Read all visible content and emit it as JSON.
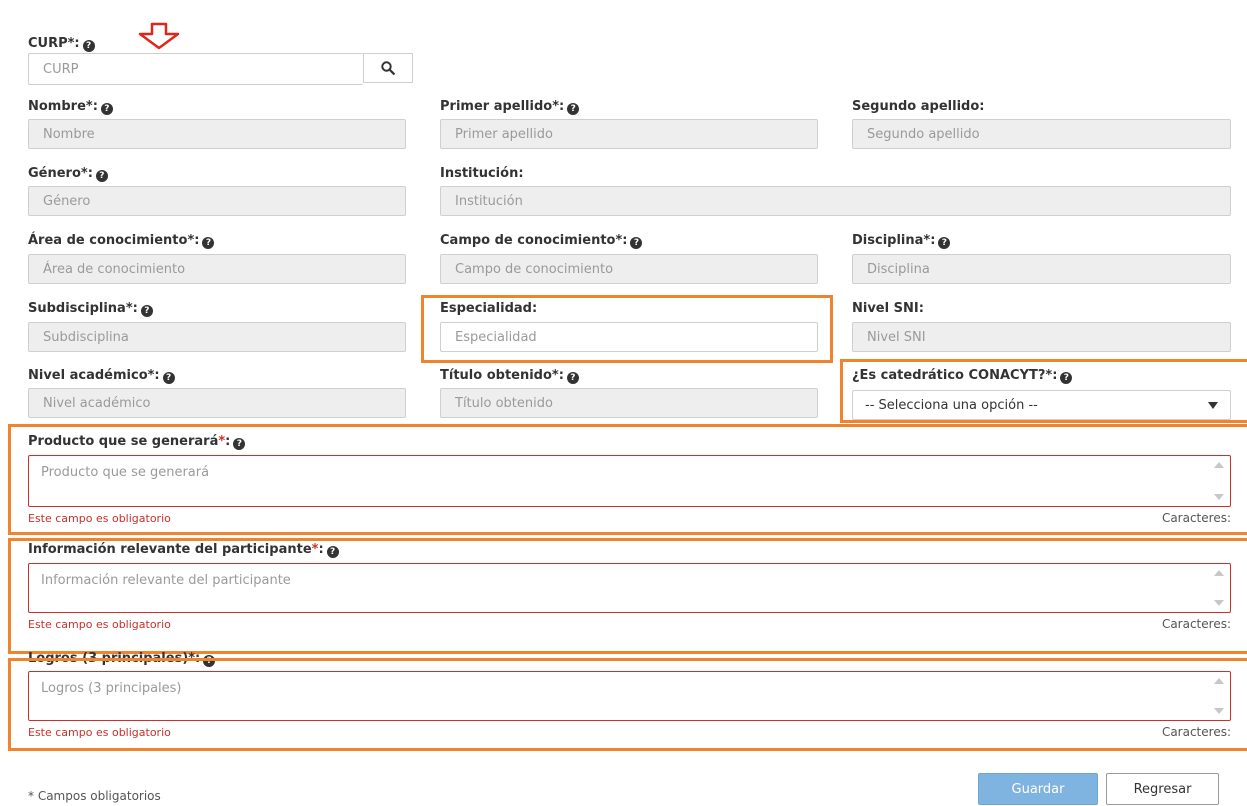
{
  "curp": {
    "label": "CURP*:",
    "placeholder": "CURP"
  },
  "row1": {
    "nombre": {
      "label": "Nombre*:",
      "placeholder": "Nombre"
    },
    "primer_apellido": {
      "label": "Primer apellido*:",
      "placeholder": "Primer apellido"
    },
    "segundo_apellido": {
      "label": "Segundo apellido:",
      "placeholder": "Segundo apellido"
    }
  },
  "row2": {
    "genero": {
      "label": "Género*:",
      "placeholder": "Género"
    },
    "institucion": {
      "label": "Institución:",
      "placeholder": "Institución"
    }
  },
  "row3": {
    "area": {
      "label": "Área de conocimiento*:",
      "placeholder": "Área de conocimiento"
    },
    "campo": {
      "label": "Campo de conocimiento*:",
      "placeholder": "Campo de conocimiento"
    },
    "disciplina": {
      "label": "Disciplina*:",
      "placeholder": "Disciplina"
    }
  },
  "row4": {
    "subdisciplina": {
      "label": "Subdisciplina*:",
      "placeholder": "Subdisciplina"
    },
    "especialidad": {
      "label": "Especialidad:",
      "placeholder": "Especialidad"
    },
    "nivel_sni": {
      "label": "Nivel SNI:",
      "placeholder": "Nivel SNI"
    }
  },
  "row5": {
    "nivel_academico": {
      "label": "Nivel académico*:",
      "placeholder": "Nivel académico"
    },
    "titulo": {
      "label": "Título obtenido*:",
      "placeholder": "Título obtenido"
    },
    "catedratico": {
      "label": "¿Es catedrático CONACYT?*:",
      "selected": "-- Selecciona una opción --"
    }
  },
  "producto": {
    "label": "Producto que se generará",
    "req": "*",
    "colon": ":",
    "placeholder": "Producto que se generará",
    "error": "Este campo es obligatorio",
    "counter": "Caracteres:"
  },
  "informacion": {
    "label": "Información relevante del participante",
    "req": "*",
    "colon": ":",
    "placeholder": "Información relevante del participante",
    "error": "Este campo es obligatorio",
    "counter": "Caracteres:"
  },
  "logros": {
    "label": "Logros (3 principales)*:",
    "placeholder": "Logros (3 principales)",
    "error": "Este campo es obligatorio",
    "counter": "Caracteres:"
  },
  "footer": {
    "required_note": "* Campos obligatorios",
    "save_label": "Guardar",
    "back_label": "Regresar"
  },
  "icons": {
    "help": "question-circle-icon",
    "search": "search-icon",
    "dropdown": "caret-down-icon",
    "pointer": "red-arrow-down-icon"
  },
  "colors": {
    "highlight": "#f0842c",
    "error": "#c9302c",
    "primary": "#7fb3e0"
  }
}
